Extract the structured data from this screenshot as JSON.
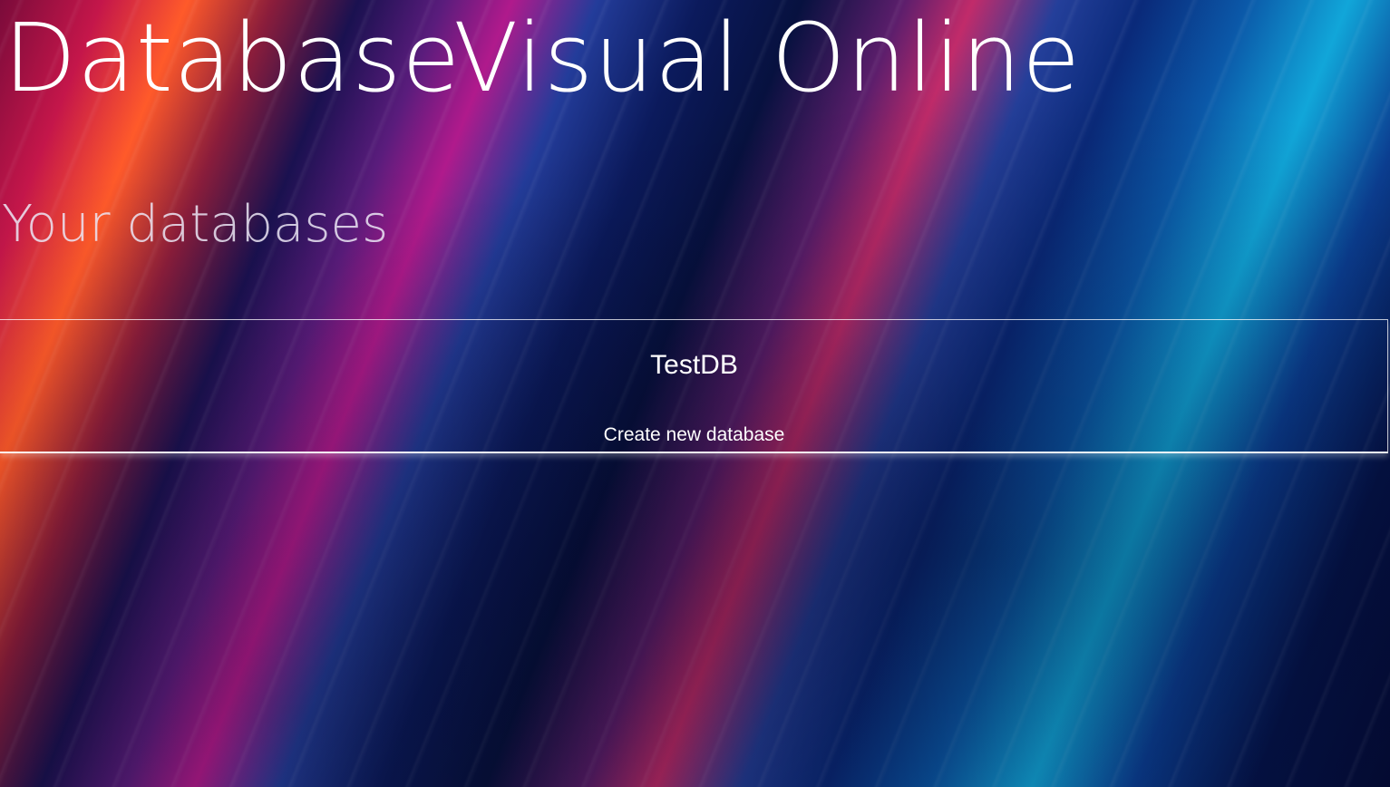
{
  "app": {
    "title": "DatabaseVisual Online"
  },
  "databases": {
    "heading": "Your databases",
    "items": [
      {
        "name": "TestDB"
      }
    ],
    "create_label": "Create new database"
  }
}
